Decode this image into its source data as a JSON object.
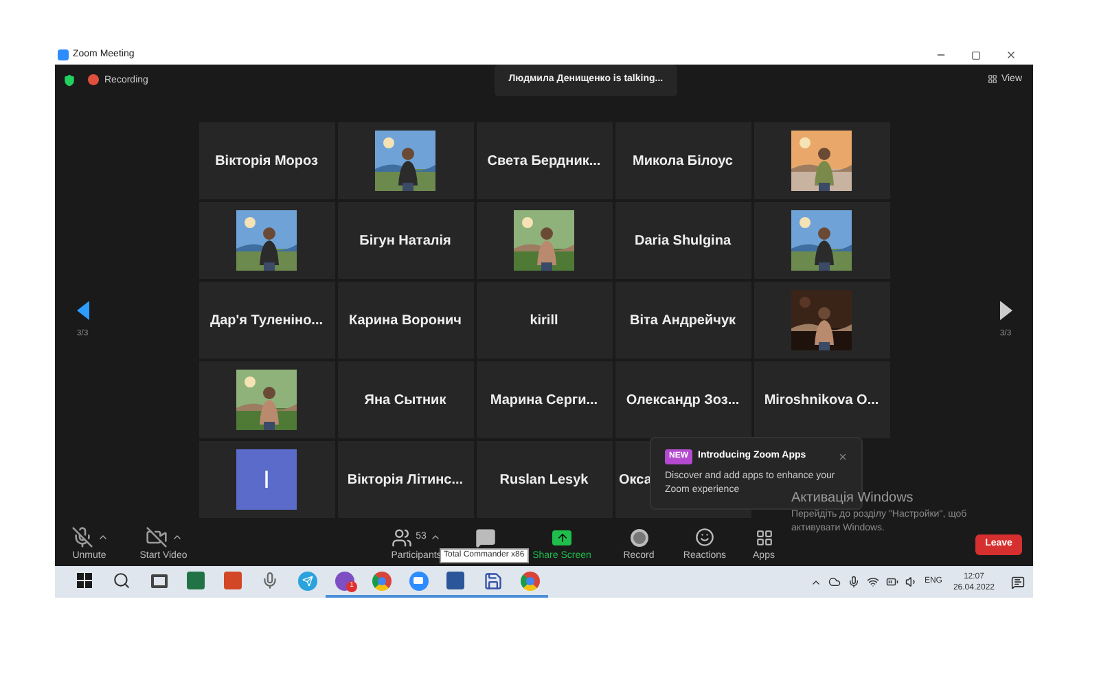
{
  "window": {
    "title": "Zoom Meeting"
  },
  "top_bar": {
    "recording": "Recording",
    "talking": "Людмила Денищенко is talking...",
    "view": "View"
  },
  "pager": {
    "left": "3/3",
    "right": "3/3"
  },
  "tiles": [
    {
      "kind": "name",
      "name": "Вікторія Мороз"
    },
    {
      "kind": "picture"
    },
    {
      "kind": "name",
      "name": "Света Бердник..."
    },
    {
      "kind": "name",
      "name": "Микола Білоус"
    },
    {
      "kind": "picture"
    },
    {
      "kind": "picture"
    },
    {
      "kind": "name",
      "name": "Бігун Наталія"
    },
    {
      "kind": "picture"
    },
    {
      "kind": "name",
      "name": "Daria Shulgina"
    },
    {
      "kind": "picture"
    },
    {
      "kind": "name",
      "name": "Дар'я Туленіно..."
    },
    {
      "kind": "name",
      "name": "Карина Воронич"
    },
    {
      "kind": "name",
      "name": "kirill"
    },
    {
      "kind": "name",
      "name": "Віта Андрейчук"
    },
    {
      "kind": "picture"
    },
    {
      "kind": "picture"
    },
    {
      "kind": "name",
      "name": "Яна Сытник"
    },
    {
      "kind": "name",
      "name": "Марина Серги..."
    },
    {
      "kind": "name",
      "name": "Олександр Зоз..."
    },
    {
      "kind": "name",
      "name": "Miroshnikova O..."
    },
    {
      "kind": "avatar",
      "initial": "I",
      "color": "#5b6bc9"
    },
    {
      "kind": "name",
      "name": "Вікторія Літинс..."
    },
    {
      "kind": "name",
      "name": "Ruslan Lesyk"
    },
    {
      "kind": "name",
      "name": "Окса",
      "partial": true
    }
  ],
  "popup": {
    "badge": "NEW",
    "title": "Introducing Zoom Apps",
    "body": "Discover and add apps to enhance your Zoom experience"
  },
  "activation": {
    "title": "Активація Windows",
    "body": "Перейдіть до розділу \"Настройки\", щоб активувати Windows."
  },
  "toolbar": [
    {
      "kind": "mic",
      "label": "Unmute",
      "muted": true
    },
    {
      "kind": "video",
      "label": "Start Video",
      "muted": true
    },
    {
      "kind": "participants",
      "label": "Participants",
      "count": "53"
    },
    {
      "kind": "chat"
    },
    {
      "kind": "share",
      "label": "Share Screen"
    },
    {
      "kind": "record",
      "label": "Record"
    },
    {
      "kind": "reactions",
      "label": "Reactions"
    },
    {
      "kind": "apps",
      "label": "Apps"
    }
  ],
  "leave": "Leave",
  "tooltip": "Total Commander x86",
  "taskbar": [
    {
      "kind": "start",
      "running": false
    },
    {
      "kind": "search",
      "running": false
    },
    {
      "kind": "taskview",
      "running": false
    },
    {
      "kind": "excel",
      "running": false
    },
    {
      "kind": "powerpoint",
      "running": false
    },
    {
      "kind": "mic",
      "running": false
    },
    {
      "kind": "telegram",
      "running": false
    },
    {
      "kind": "viber",
      "running": true,
      "badge": "1"
    },
    {
      "kind": "chrome",
      "running": true
    },
    {
      "kind": "zoom",
      "running": true
    },
    {
      "kind": "word",
      "running": true
    },
    {
      "kind": "save",
      "running": true
    },
    {
      "kind": "chrome",
      "running": true
    }
  ],
  "tray": {
    "language": "ENG",
    "time": "12:07",
    "date": "26.04.2022"
  }
}
